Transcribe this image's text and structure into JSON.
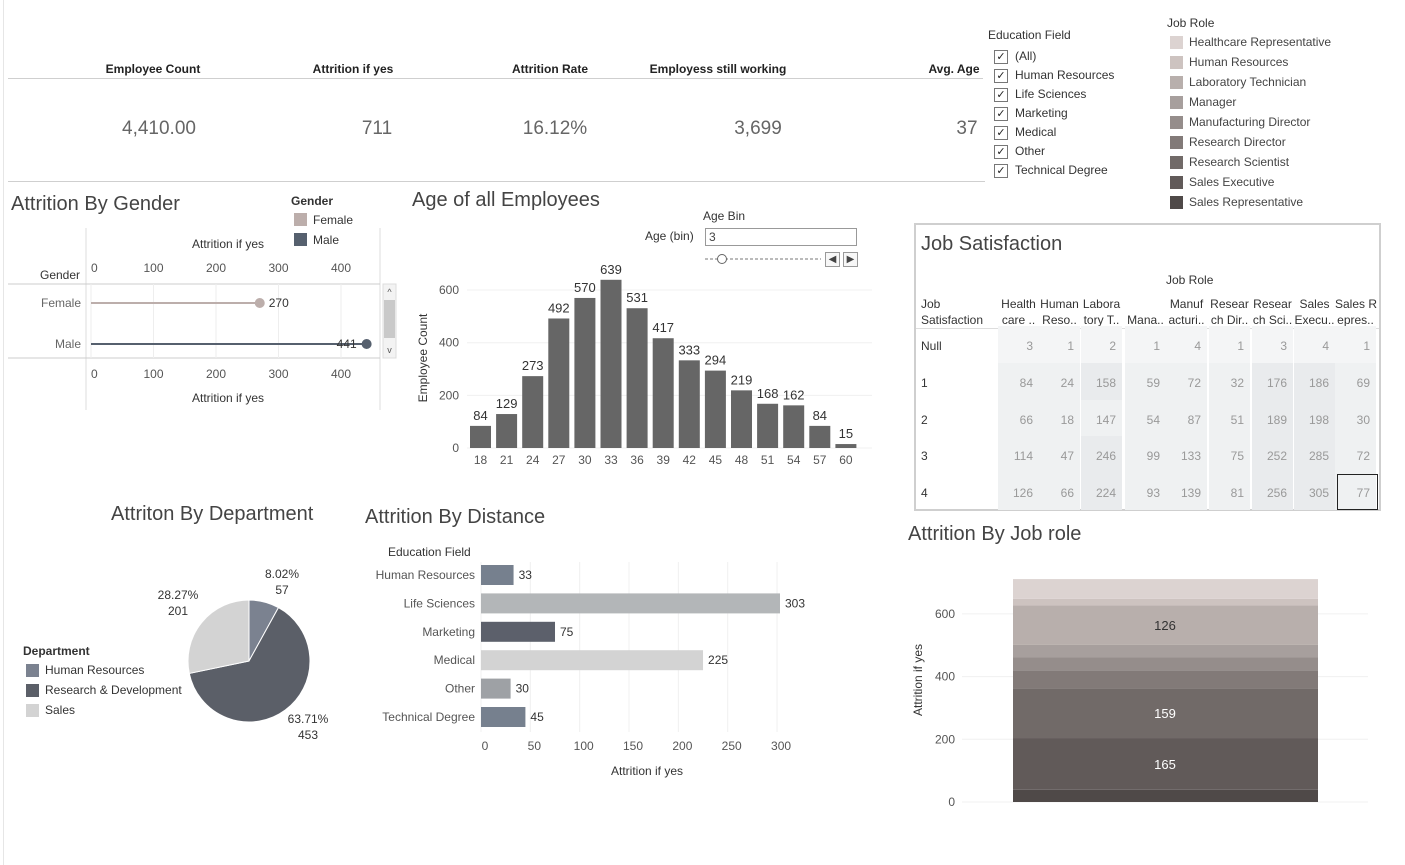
{
  "kpis": [
    {
      "label": "Employee Count",
      "value": "4,410.00"
    },
    {
      "label": "Attrition if yes",
      "value": "711"
    },
    {
      "label": "Attrition Rate",
      "value": "16.12%"
    },
    {
      "label": "Employess still working",
      "value": "3,699"
    },
    {
      "label": "Avg. Age",
      "value": "37"
    }
  ],
  "education_filter": {
    "title": "Education Field",
    "items": [
      "(All)",
      "Human Resources",
      "Life Sciences",
      "Marketing",
      "Medical",
      "Other",
      "Technical Degree"
    ]
  },
  "jobrole_legend": {
    "title": "Job Role",
    "items": [
      {
        "label": "Healthcare Representative",
        "color": "#dcd3d1"
      },
      {
        "label": "Human Resources",
        "color": "#cdc3c0"
      },
      {
        "label": "Laboratory Technician",
        "color": "#b8afac"
      },
      {
        "label": "Manager",
        "color": "#a79f9d"
      },
      {
        "label": "Manufacturing Director",
        "color": "#958d8b"
      },
      {
        "label": "Research Director",
        "color": "#827a78"
      },
      {
        "label": "Research Scientist",
        "color": "#716a68"
      },
      {
        "label": "Sales Executive",
        "color": "#615a59"
      },
      {
        "label": "Sales Representative",
        "color": "#4f4948"
      }
    ]
  },
  "gender_chart": {
    "title": "Attrition By Gender",
    "legend_title": "Gender",
    "legend": [
      {
        "label": "Female",
        "color": "#bcaeab"
      },
      {
        "label": "Male",
        "color": "#56606e"
      }
    ],
    "axis_label": "Attrition if yes",
    "row_header": "Gender"
  },
  "age_chart": {
    "title": "Age of all Employees",
    "param_title": "Age Bin",
    "param_label": "Age (bin)",
    "param_value": "3",
    "ylabel": "Employee Count"
  },
  "job_satisfaction": {
    "title": "Job Satisfaction",
    "col_group": "Job Role",
    "row_header": [
      "Job",
      "Satisfaction"
    ],
    "columns": [
      [
        "Health",
        "care .."
      ],
      [
        "Human",
        "Reso.."
      ],
      [
        "Labora",
        "tory T.."
      ],
      [
        "",
        "Mana.."
      ],
      [
        "Manuf",
        "acturi.."
      ],
      [
        "Resear",
        "ch Dir.."
      ],
      [
        "Resear",
        "ch Sci.."
      ],
      [
        "Sales",
        "Execu.."
      ],
      [
        "Sales R",
        "epres.."
      ]
    ],
    "rows": [
      {
        "label": "Null",
        "values": [
          "3",
          "1",
          "2",
          "1",
          "4",
          "1",
          "3",
          "4",
          "1"
        ]
      },
      {
        "label": "1",
        "values": [
          "84",
          "24",
          "158",
          "59",
          "72",
          "32",
          "176",
          "186",
          "69"
        ]
      },
      {
        "label": "2",
        "values": [
          "66",
          "18",
          "147",
          "54",
          "87",
          "51",
          "189",
          "198",
          "30"
        ]
      },
      {
        "label": "3",
        "values": [
          "114",
          "47",
          "246",
          "99",
          "133",
          "75",
          "252",
          "285",
          "72"
        ]
      },
      {
        "label": "4",
        "values": [
          "126",
          "66",
          "224",
          "93",
          "139",
          "81",
          "256",
          "305",
          "77"
        ]
      }
    ]
  },
  "dept_chart": {
    "title": "Attriton By Department",
    "legend_title": "Department"
  },
  "distance_chart": {
    "title": "Attrition By Distance",
    "row_header": "Education Field",
    "xlabel": "Attrition if yes"
  },
  "jobrole_chart": {
    "title": "Attrition By Job role",
    "ylabel": "Attrition if yes"
  },
  "chart_data": [
    {
      "type": "bar",
      "orientation": "horizontal-lollipop",
      "title": "Attrition By Gender",
      "categories": [
        "Female",
        "Male"
      ],
      "values": [
        270,
        441
      ],
      "colors": [
        "#bcaeab",
        "#56606e"
      ],
      "xlabel": "Attrition if yes",
      "xlim": [
        0,
        470
      ],
      "xticks": [
        0,
        100,
        200,
        300,
        400
      ]
    },
    {
      "type": "bar",
      "title": "Age of all Employees",
      "categories": [
        "18",
        "21",
        "24",
        "27",
        "30",
        "33",
        "36",
        "39",
        "42",
        "45",
        "48",
        "51",
        "54",
        "57",
        "60"
      ],
      "values": [
        84,
        129,
        273,
        492,
        570,
        639,
        531,
        417,
        333,
        294,
        219,
        168,
        162,
        84,
        15
      ],
      "ylabel": "Employee Count",
      "ylim": [
        0,
        680
      ],
      "yticks": [
        0,
        200,
        400,
        600
      ],
      "color": "#666666"
    },
    {
      "type": "pie",
      "title": "Attriton By Department",
      "labels": [
        "Human Resources",
        "Research & Development",
        "Sales"
      ],
      "values": [
        57,
        453,
        201
      ],
      "percents": [
        "8.02%",
        "63.71%",
        "28.27%"
      ],
      "colors": [
        "#7b8290",
        "#5b5f68",
        "#d3d3d3"
      ],
      "legend": "left"
    },
    {
      "type": "bar",
      "orientation": "horizontal",
      "title": "Attrition By Distance",
      "categories": [
        "Human Resources",
        "Life Sciences",
        "Marketing",
        "Medical",
        "Other",
        "Technical Degree"
      ],
      "values": [
        33,
        303,
        75,
        225,
        30,
        45
      ],
      "colors": [
        "#76808e",
        "#b3b6b8",
        "#5c606b",
        "#d3d3d3",
        "#9ea1a5",
        "#76808e"
      ],
      "xlabel": "Attrition if yes",
      "xlim": [
        0,
        340
      ],
      "xticks": [
        0,
        50,
        100,
        150,
        200,
        250,
        300
      ]
    },
    {
      "type": "bar",
      "orientation": "stacked",
      "title": "Attrition By Job role",
      "series": [
        {
          "name": "Sales Representative",
          "values": [
            39
          ],
          "color": "#4f4948"
        },
        {
          "name": "Sales Executive",
          "values": [
            165
          ],
          "color": "#615a59"
        },
        {
          "name": "Research Scientist",
          "values": [
            159
          ],
          "color": "#716a68"
        },
        {
          "name": "Research Director",
          "values": [
            57
          ],
          "color": "#827a78"
        },
        {
          "name": "Manufacturing Director",
          "values": [
            41
          ],
          "color": "#958d8b"
        },
        {
          "name": "Manager",
          "values": [
            40
          ],
          "color": "#a79f9d"
        },
        {
          "name": "Laboratory Technician",
          "values": [
            126
          ],
          "color": "#b8afac"
        },
        {
          "name": "Human Resources",
          "values": [
            21
          ],
          "color": "#cdc3c0"
        },
        {
          "name": "Healthcare Representative",
          "values": [
            63
          ],
          "color": "#dcd3d1"
        }
      ],
      "data_labels": [
        "165",
        "159",
        "126"
      ],
      "ylabel": "Attrition if yes",
      "ylim": [
        0,
        740
      ],
      "yticks": [
        0,
        200,
        400,
        600
      ]
    }
  ]
}
